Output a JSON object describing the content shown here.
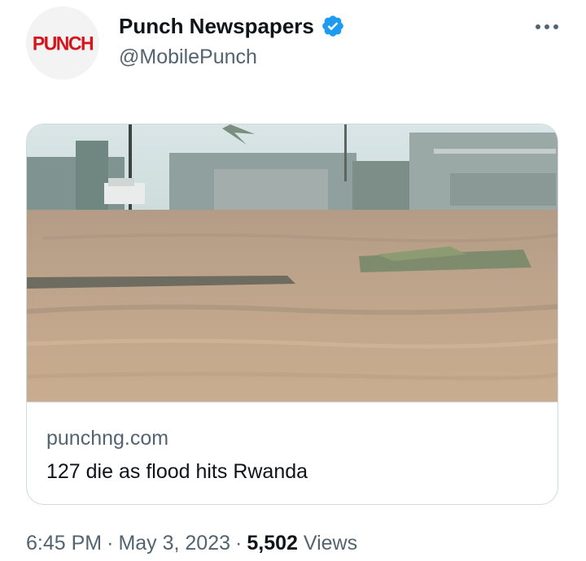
{
  "author": {
    "display_name": "Punch Newspapers",
    "handle": "@MobilePunch",
    "avatar_text": "PUNCH",
    "verified": true
  },
  "card": {
    "domain": "punchng.com",
    "title": "127 die as flood hits Rwanda"
  },
  "footer": {
    "time": "6:45 PM",
    "date": "May 3, 2023",
    "separator": "·",
    "views_count": "5,502",
    "views_label": "Views"
  },
  "icons": {
    "verified": "verified-badge-icon",
    "more": "more-options-icon"
  },
  "colors": {
    "verified_blue": "#1d9bf0",
    "secondary_text": "#536471",
    "logo_red": "#d7141a",
    "border": "#cfd9de"
  }
}
